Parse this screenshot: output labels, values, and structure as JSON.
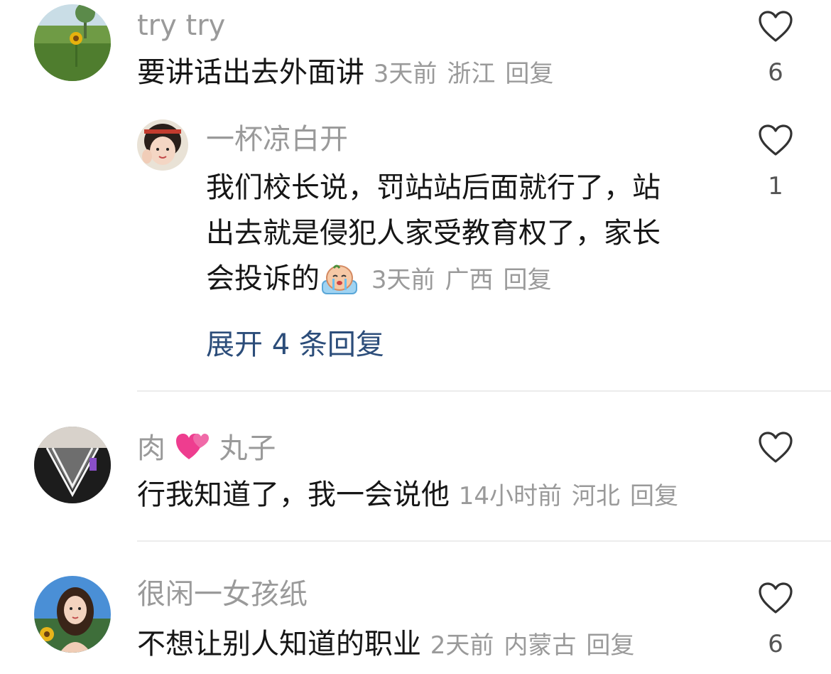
{
  "comments": [
    {
      "username": "try try",
      "text": "要讲话出去外面讲",
      "time": "3天前",
      "location": "浙江",
      "reply_label": "回复",
      "likes": "6",
      "avatar": "sunflower-field-avatar"
    },
    {
      "username": "一杯凉白开",
      "text_line1": "我们校长说，罚站站后面就行了，站",
      "text_line2": "出去就是侵犯人家受教育权了，家长",
      "text_line3": "会投诉的",
      "emoji": "crying-emoji",
      "time": "3天前",
      "location": "广西",
      "reply_label": "回复",
      "likes": "1",
      "avatar": "girl-waving-avatar",
      "expand_label": "展开 4 条回复"
    },
    {
      "username_part1": "肉",
      "username_emoji": "hearts-emoji",
      "username_part2": "丸子",
      "text": "行我知道了，我一会说他",
      "time": "14小时前",
      "location": "河北",
      "reply_label": "回复",
      "likes": "",
      "avatar": "sweater-avatar"
    },
    {
      "username": "很闲一女孩纸",
      "text": "不想让别人知道的职业",
      "time": "2天前",
      "location": "内蒙古",
      "reply_label": "回复",
      "likes": "6",
      "avatar": "girl-sunflower-avatar"
    }
  ],
  "colors": {
    "username": "#9a9a9a",
    "text": "#161616",
    "link": "#2c4d7a",
    "divider": "#ececec"
  }
}
